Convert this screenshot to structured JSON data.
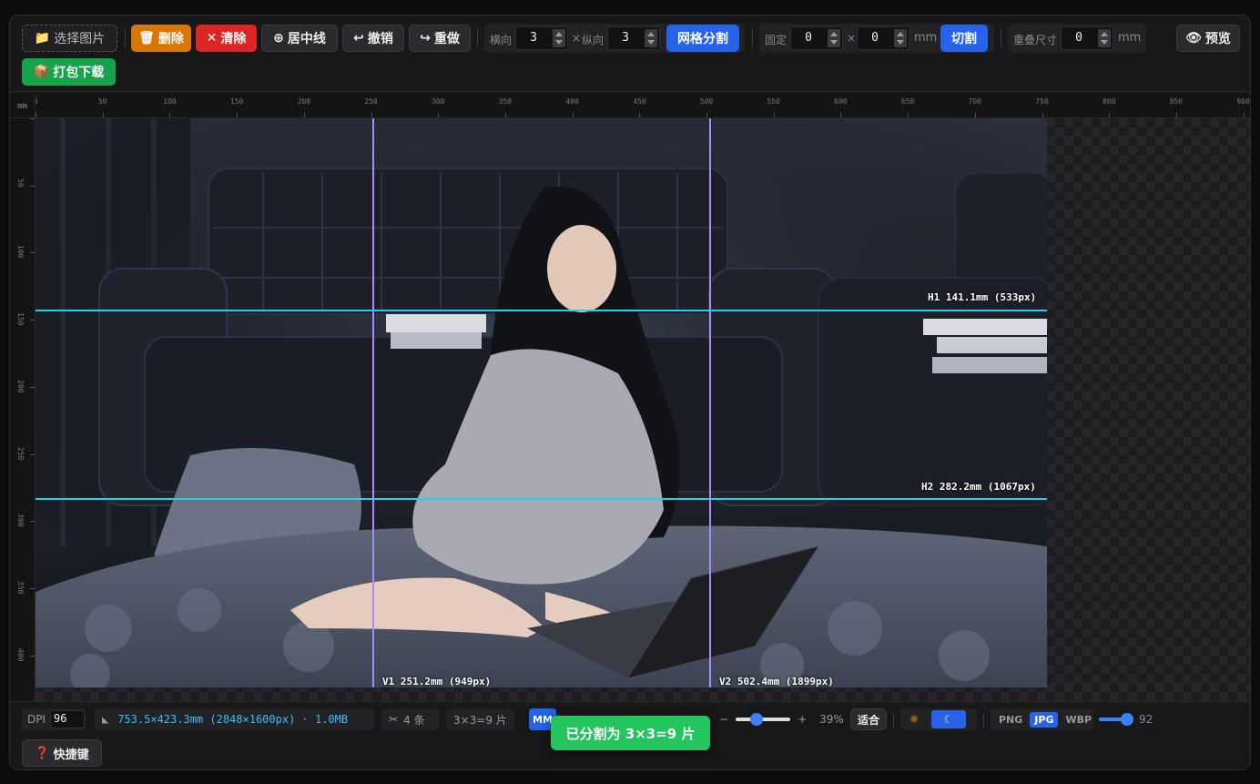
{
  "toolbar": {
    "select_image": "选择图片",
    "delete": "删除",
    "clear": "清除",
    "center_line": "居中线",
    "undo": "撤销",
    "redo": "重做",
    "horizontal_label": "横向",
    "horizontal_value": "3",
    "times": "×",
    "vertical_label": "纵向",
    "vertical_value": "3",
    "grid_split": "网格分割",
    "fixed_label": "固定",
    "fixed_w": "0",
    "fixed_h": "0",
    "fixed_unit": "mm",
    "cut": "切割",
    "overlap_label": "重叠尺寸",
    "overlap_value": "0",
    "overlap_unit": "mm",
    "preview": "预览",
    "pack_download": "打包下载"
  },
  "ruler": {
    "unit": "mm",
    "top_ticks": [
      "0",
      "50",
      "100",
      "150",
      "200",
      "250",
      "300",
      "350",
      "400",
      "450",
      "500",
      "550",
      "600",
      "650",
      "700",
      "750",
      "800",
      "850",
      "900"
    ],
    "left_ticks": [
      "0",
      "50",
      "100",
      "150",
      "200",
      "250",
      "300",
      "350",
      "400"
    ]
  },
  "guides": {
    "h1": "H1 141.1mm (533px)",
    "h2": "H2 282.2mm (1067px)",
    "v1": "V1 251.2mm (949px)",
    "v2": "V2 502.4mm (1899px)"
  },
  "status": {
    "dpi_label": "DPI",
    "dpi_value": "96",
    "dimensions": "753.5×423.3mm (2848×1600px) · 1.0MB",
    "lines_count": "4 条",
    "grid_summary": "3×3=9 片",
    "unit_mm": "MM",
    "zoom_minus": "−",
    "zoom_plus": "+",
    "zoom_value": "39%",
    "zoom_percent": 39,
    "fit": "适合",
    "format_png": "PNG",
    "format_jpg": "JPG",
    "format_webp": "WBP",
    "quality": "92",
    "quality_fraction": 0.92,
    "shortcuts": "快捷键",
    "toast": "已分割为 3×3=9 片"
  },
  "colors": {
    "horizontal_guide": "#22d3ee",
    "vertical_guide": "#a78bfa",
    "accent": "#2563eb"
  }
}
